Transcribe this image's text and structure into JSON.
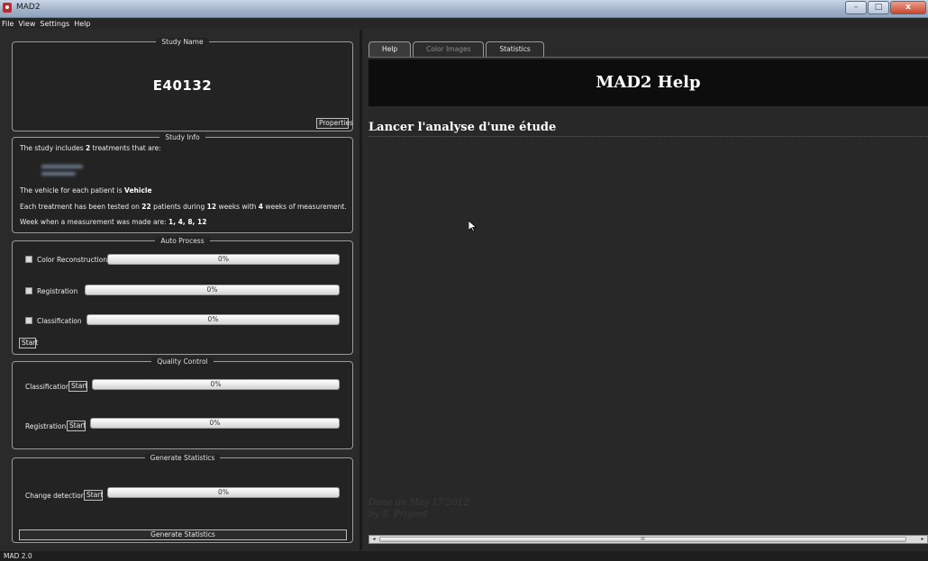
{
  "window": {
    "title": "MAD2",
    "buttons": {
      "minimize": "–",
      "maximize": "□",
      "close": "x"
    }
  },
  "menu": [
    "File",
    "View",
    "Settings",
    "Help"
  ],
  "study_name": {
    "title": "Study Name",
    "value": "E40132",
    "properties_button": "Properties"
  },
  "study_info": {
    "title": "Study Info",
    "line1_pre": "The study includes ",
    "line1_num": "2",
    "line1_post": " treatments that are:",
    "line2_pre": "The vehicle for each patient is ",
    "line2_val": "Vehicle",
    "line3_a": "Each treatment has been tested on ",
    "line3_b": "22",
    "line3_c": " patients during ",
    "line3_d": "12",
    "line3_e": " weeks with ",
    "line3_f": "4",
    "line3_g": " weeks of measurement.",
    "line4_pre": "Week when a measurement was made are: ",
    "line4_val": "1, 4, 8, 12"
  },
  "auto_process": {
    "title": "Auto Process",
    "rows": [
      {
        "label": "Color Reconstruction",
        "progress": "0%"
      },
      {
        "label": "Registration",
        "progress": "0%"
      },
      {
        "label": "Classification",
        "progress": "0%"
      }
    ],
    "start_button": "Start"
  },
  "quality_control": {
    "title": "Quality Control",
    "rows": [
      {
        "label": "Classification",
        "button": "Start",
        "progress": "0%"
      },
      {
        "label": "Registration",
        "button": "Start",
        "progress": "0%"
      }
    ]
  },
  "generate_statistics": {
    "title": "Generate Statistics",
    "row": {
      "label": "Change detection",
      "button": "Start",
      "progress": "0%"
    },
    "generate_button": "Generate Statistics"
  },
  "tabs": [
    "Help",
    "Color Images",
    "Statistics"
  ],
  "help": {
    "banner": "MAD2 Help",
    "heading": "Lancer l'analyse d'une étude",
    "footer1": "Done on May 17 2012",
    "footer2": "by S. Prigent"
  },
  "scrollbar": {
    "thumb_grip": "III",
    "left_arrow": "◂",
    "right_arrow": "▸"
  },
  "status": "MAD 2.0"
}
